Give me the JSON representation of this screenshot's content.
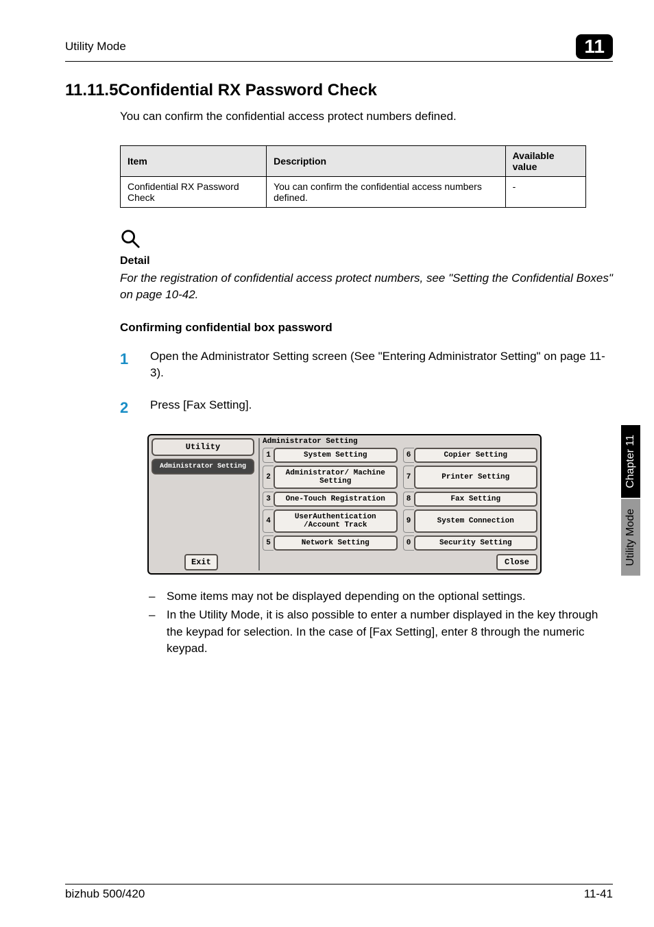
{
  "header": {
    "chapter_name": "Utility Mode",
    "chapter_number": "11"
  },
  "section": {
    "title": "11.11.5Confidential RX Password Check",
    "intro": "You can confirm the confidential access protect numbers defined."
  },
  "table": {
    "headers": {
      "item": "Item",
      "description": "Description",
      "available": "Available value"
    },
    "row": {
      "item": "Confidential RX Password Check",
      "description": "You can confirm the confidential access numbers defined.",
      "available": "-"
    }
  },
  "detail": {
    "label": "Detail",
    "text": "For the registration of confidential access protect numbers, see \"Setting the Confidential Boxes\" on page 10-42."
  },
  "subheading": "Confirming confidential box password",
  "steps": {
    "s1": {
      "num": "1",
      "text": "Open the Administrator Setting screen (See \"Entering Administrator Setting\" on page 11-3)."
    },
    "s2": {
      "num": "2",
      "text": "Press [Fax Setting]."
    }
  },
  "panel": {
    "utility": "Utility",
    "admin": "Administrator Setting",
    "heading": "Administrator Setting",
    "exit": "Exit",
    "close": "Close",
    "items": {
      "i1": {
        "n": "1",
        "l": "System Setting"
      },
      "i2": {
        "n": "2",
        "l": "Administrator/ Machine Setting"
      },
      "i3": {
        "n": "3",
        "l": "One-Touch Registration"
      },
      "i4": {
        "n": "4",
        "l": "UserAuthentication /Account Track"
      },
      "i5": {
        "n": "5",
        "l": "Network Setting"
      },
      "i6": {
        "n": "6",
        "l": "Copier Setting"
      },
      "i7": {
        "n": "7",
        "l": "Printer Setting"
      },
      "i8": {
        "n": "8",
        "l": "Fax Setting"
      },
      "i9": {
        "n": "9",
        "l": "System Connection"
      },
      "i0": {
        "n": "0",
        "l": "Security Setting"
      }
    }
  },
  "notes": {
    "n1": "Some items may not be displayed depending on the optional settings.",
    "n2": "In the Utility Mode, it is also possible to enter a number displayed in the key through the keypad for selection. In the case of [Fax Setting], enter 8 through the numeric keypad."
  },
  "sidetab": {
    "black": "Chapter 11",
    "grey": "Utility Mode"
  },
  "footer": {
    "left": "bizhub 500/420",
    "right": "11-41"
  }
}
